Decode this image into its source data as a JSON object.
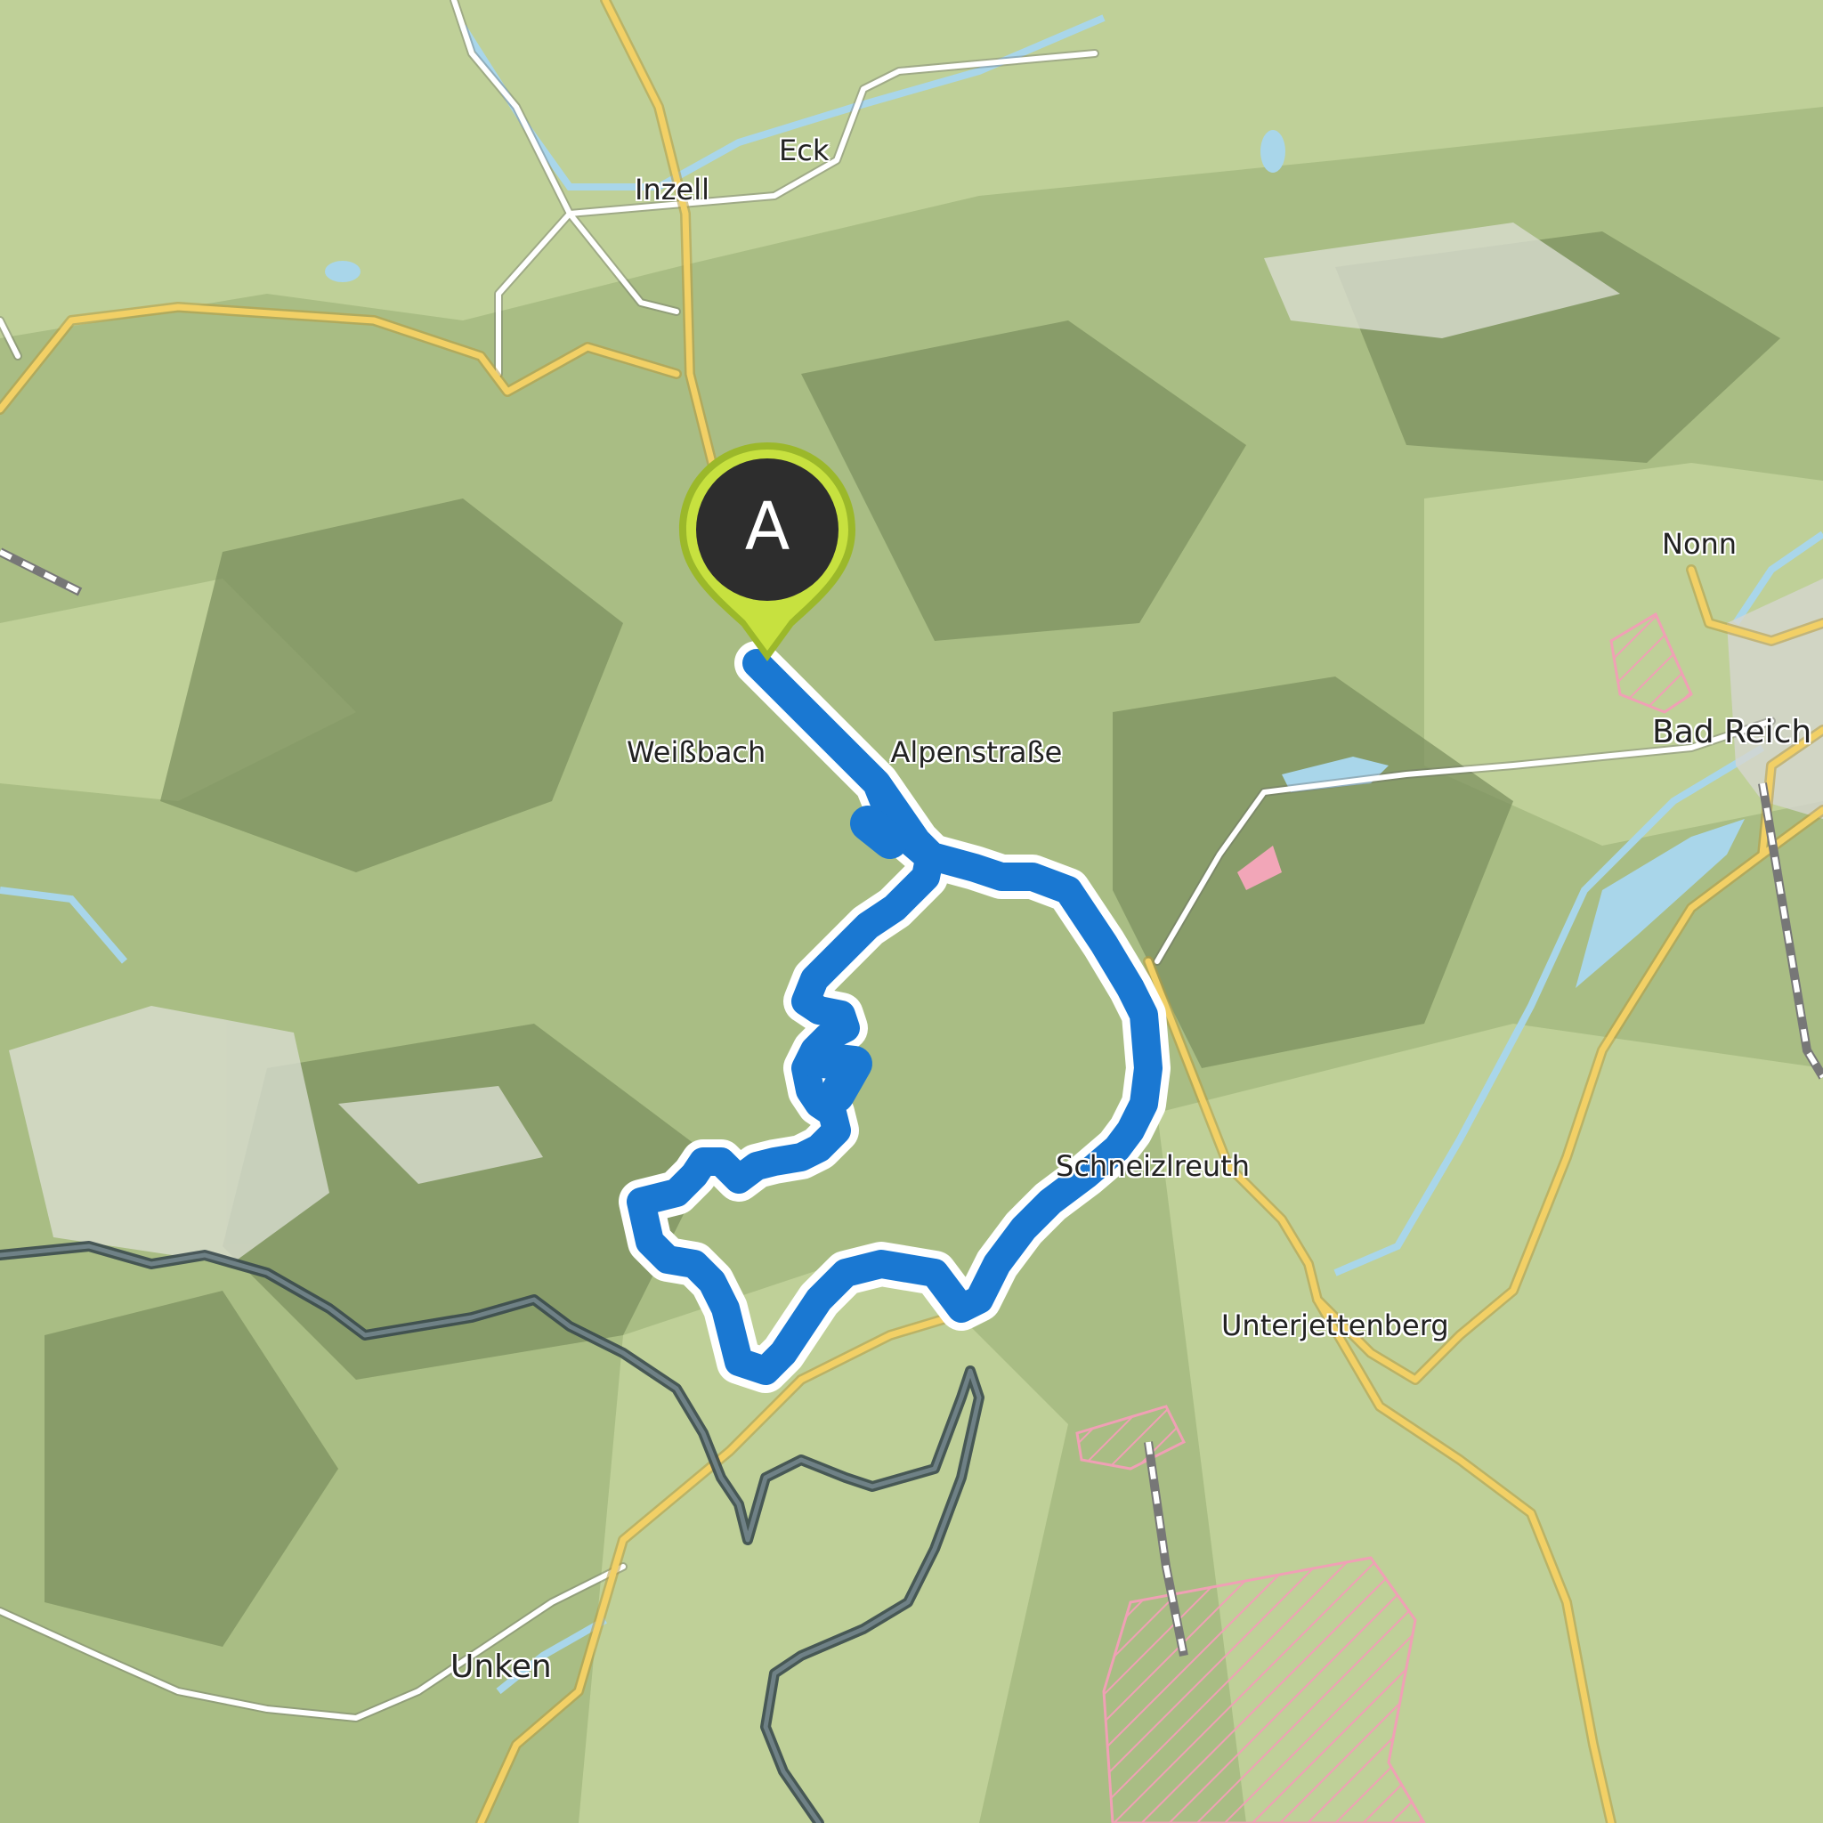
{
  "map": {
    "places": {
      "inzell": "Inzell",
      "eck": "Eck",
      "nonn": "Nonn",
      "bad_reich": "Bad Reich",
      "weissbach_a": "Weißbach",
      "weissbach_b": "Alpenstraße",
      "schneizlreuth": "Schneizlreuth",
      "unterjettenberg": "Unterjettenberg",
      "unken": "Unken"
    },
    "start_marker": {
      "label": "A",
      "color": "#b4d233",
      "inner": "#2d2d2d"
    },
    "route": {
      "color": "#1a78d2",
      "casing": "#ffffff"
    },
    "colors": {
      "terrain": "#a9bd84",
      "road_major": "#f2d066",
      "road_minor": "#ffffff",
      "water": "#a9d6ea",
      "border": "#5f6f73",
      "protected": "#f2a6b8"
    }
  }
}
